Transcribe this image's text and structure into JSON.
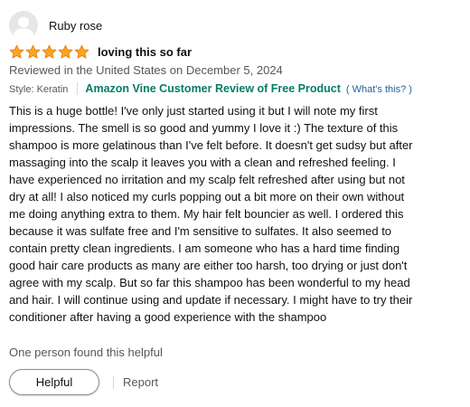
{
  "profile": {
    "name": "Ruby rose",
    "avatar_icon": "default-user-avatar"
  },
  "rating": {
    "stars": 5,
    "max": 5,
    "star_color": "#ffa41c"
  },
  "review": {
    "title": "loving this so far",
    "date_line": "Reviewed in the United States on December 5, 2024",
    "format": "Style: Keratin",
    "vine_badge": "Amazon Vine Customer Review of Free Product",
    "vine_help": "( What's this? )",
    "body_lines": [
      "This is a huge bottle! I've only just started using it but I will note my first",
      "impressions. The smell is so good and yummy I love it :) The texture of this",
      "shampoo is more gelatinous than I've felt before. It doesn't get sudsy but after",
      "massaging into the scalp it leaves you with a clean and refreshed feeling. I",
      "have experienced no irritation and my scalp felt refreshed after using but not",
      "dry at all! I also noticed my curls popping out a bit more on their own without",
      "me doing anything extra to them. My hair felt bouncier as well. I ordered this",
      "because it was sulfate free and I'm sensitive to sulfates. It also seemed to",
      "contain pretty clean ingredients. I am someone who has a hard time finding",
      "good hair care products as many are either too harsh, too drying or just don't",
      "agree with my scalp. But so far this shampoo has been wonderful to my head",
      "and hair. I will continue using and update if necessary. I might have to try their",
      "conditioner after having a good experience with the shampoo"
    ],
    "helpful_count": "One person found this helpful"
  },
  "actions": {
    "helpful_label": "Helpful",
    "report_label": "Report"
  },
  "colors": {
    "vine_green": "#067d62",
    "link_blue": "#2162a1",
    "secondary_text": "#565959"
  }
}
